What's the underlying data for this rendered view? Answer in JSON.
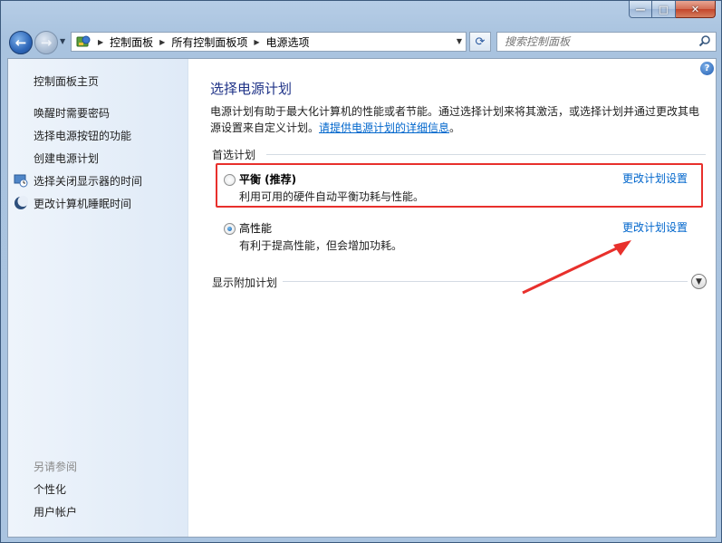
{
  "window": {
    "caption": {
      "minimize": "—",
      "maximize": "□",
      "close": "✕"
    }
  },
  "nav": {
    "back": "←",
    "forward": "→",
    "recent": "▼",
    "breadcrumb": [
      "控制面板",
      "所有控制面板项",
      "电源选项"
    ],
    "refresh": "⟳",
    "search_placeholder": "搜索控制面板"
  },
  "sidebar": {
    "home": "控制面板主页",
    "items": [
      {
        "label": "唤醒时需要密码",
        "icon": null
      },
      {
        "label": "选择电源按钮的功能",
        "icon": null
      },
      {
        "label": "创建电源计划",
        "icon": null
      },
      {
        "label": "选择关闭显示器的时间",
        "icon": "monitor-clock-icon"
      },
      {
        "label": "更改计算机睡眠时间",
        "icon": "moon-icon"
      }
    ],
    "see_also": {
      "heading": "另请参阅",
      "items": [
        "个性化",
        "用户帐户"
      ]
    }
  },
  "main": {
    "title": "选择电源计划",
    "description": "电源计划有助于最大化计算机的性能或者节能。通过选择计划来将其激活，或选择计划并通过更改其电源设置来自定义计划。",
    "description_link": "请提供电源计划的详细信息",
    "description_end": "。",
    "preferred_heading": "首选计划",
    "plans": [
      {
        "name": "平衡 (推荐)",
        "desc": "利用可用的硬件自动平衡功耗与性能。",
        "selected": false,
        "change_label": "更改计划设置"
      },
      {
        "name": "高性能",
        "desc": "有利于提高性能，但会增加功耗。",
        "selected": true,
        "change_label": "更改计划设置"
      }
    ],
    "additional_heading": "显示附加计划",
    "help": "?"
  },
  "colors": {
    "annotation": "#e8302c",
    "link": "#0066cc",
    "title": "#1e3287"
  }
}
